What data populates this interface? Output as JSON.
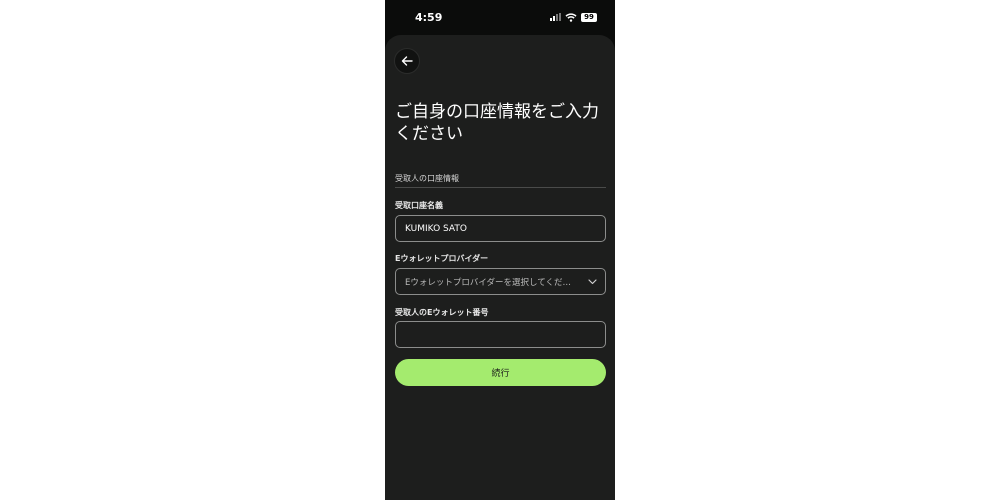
{
  "status_bar": {
    "time": "4:59",
    "battery": "99",
    "icons": [
      "signal-icon",
      "wifi-icon",
      "battery-icon"
    ]
  },
  "header": {
    "back_icon": "arrow-left-icon",
    "title": "ご自身の口座情報をご入力ください"
  },
  "form": {
    "section_label": "受取人の口座情報",
    "account_name": {
      "label": "受取口座名義",
      "value": "KUMIKO SATO"
    },
    "provider": {
      "label": "Eウォレットプロバイダー",
      "placeholder": "Eウォレットプロバイダーを選択してくだ…",
      "icon": "chevron-down-icon"
    },
    "wallet_number": {
      "label": "受取人のEウォレット番号",
      "value": ""
    },
    "continue_label": "続行"
  },
  "colors": {
    "background": "#1d1e1d",
    "accent": "#a4eb6e",
    "border": "#8c8d8c"
  }
}
